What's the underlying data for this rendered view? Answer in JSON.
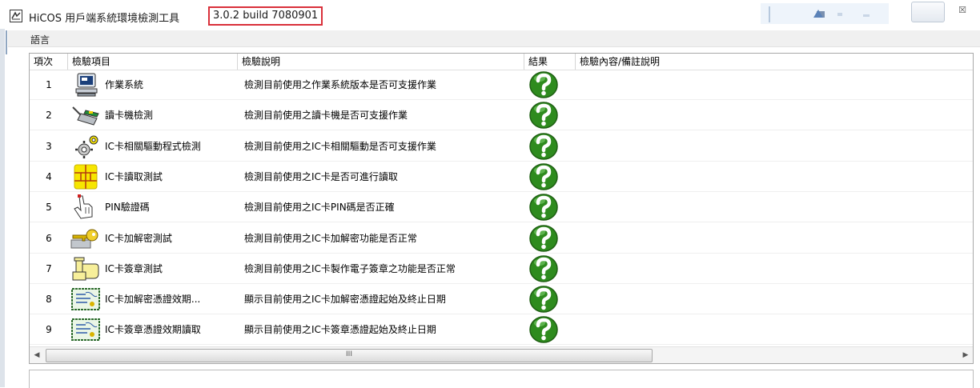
{
  "window": {
    "title": "HiCOS 用戶端系統環境檢測工具",
    "version": "3.0.2 build 7080901",
    "close_glyph": "☒"
  },
  "menu": {
    "language": "語言"
  },
  "columns": [
    "項次",
    "檢驗項目",
    "檢驗說明",
    "結果",
    "檢驗內容/備註說明"
  ],
  "rows": [
    {
      "index": "1",
      "icon": "computer-icon",
      "item": "作業系統",
      "description": "檢測目前使用之作業系統版本是否可支援作業",
      "result_icon": "question-mark-icon",
      "note": ""
    },
    {
      "index": "2",
      "icon": "card-reader-icon",
      "item": "讀卡機檢測",
      "description": "檢測目前使用之讀卡機是否可支援作業",
      "result_icon": "question-mark-icon",
      "note": ""
    },
    {
      "index": "3",
      "icon": "gear-icon",
      "item": "IC卡相關驅動程式檢測",
      "description": "檢測目前使用之IC卡相關驅動是否可支援作業",
      "result_icon": "question-mark-icon",
      "note": ""
    },
    {
      "index": "4",
      "icon": "chip-icon",
      "item": "IC卡讀取測試",
      "description": "檢測目前使用之IC卡是否可進行讀取",
      "result_icon": "question-mark-icon",
      "note": ""
    },
    {
      "index": "5",
      "icon": "hand-pointer-icon",
      "item": "PIN驗證碼",
      "description": "檢測目前使用之IC卡PIN碼是否正確",
      "result_icon": "question-mark-icon",
      "note": ""
    },
    {
      "index": "6",
      "icon": "key-icon",
      "item": "IC卡加解密測試",
      "description": "檢測目前使用之IC卡加解密功能是否正常",
      "result_icon": "question-mark-icon",
      "note": ""
    },
    {
      "index": "7",
      "icon": "stamp-icon",
      "item": "IC卡簽章測試",
      "description": "檢測目前使用之IC卡製作電子簽章之功能是否正常",
      "result_icon": "question-mark-icon",
      "note": ""
    },
    {
      "index": "8",
      "icon": "certificate-icon",
      "item": "IC卡加解密憑證效期...",
      "description": "顯示目前使用之IC卡加解密憑證起始及終止日期",
      "result_icon": "question-mark-icon",
      "note": ""
    },
    {
      "index": "9",
      "icon": "certificate-icon",
      "item": "IC卡簽章憑證效期讀取",
      "description": "顯示目前使用之IC卡簽章憑證起始及終止日期",
      "result_icon": "question-mark-icon",
      "note": ""
    }
  ],
  "scrollbar": {
    "left_arrow": "◀",
    "right_arrow": "▶",
    "grip": "III"
  },
  "colors": {
    "highlight_border": "#d9303a",
    "result_green": "#2e8b1e",
    "chip_yellow": "#f7e600"
  }
}
